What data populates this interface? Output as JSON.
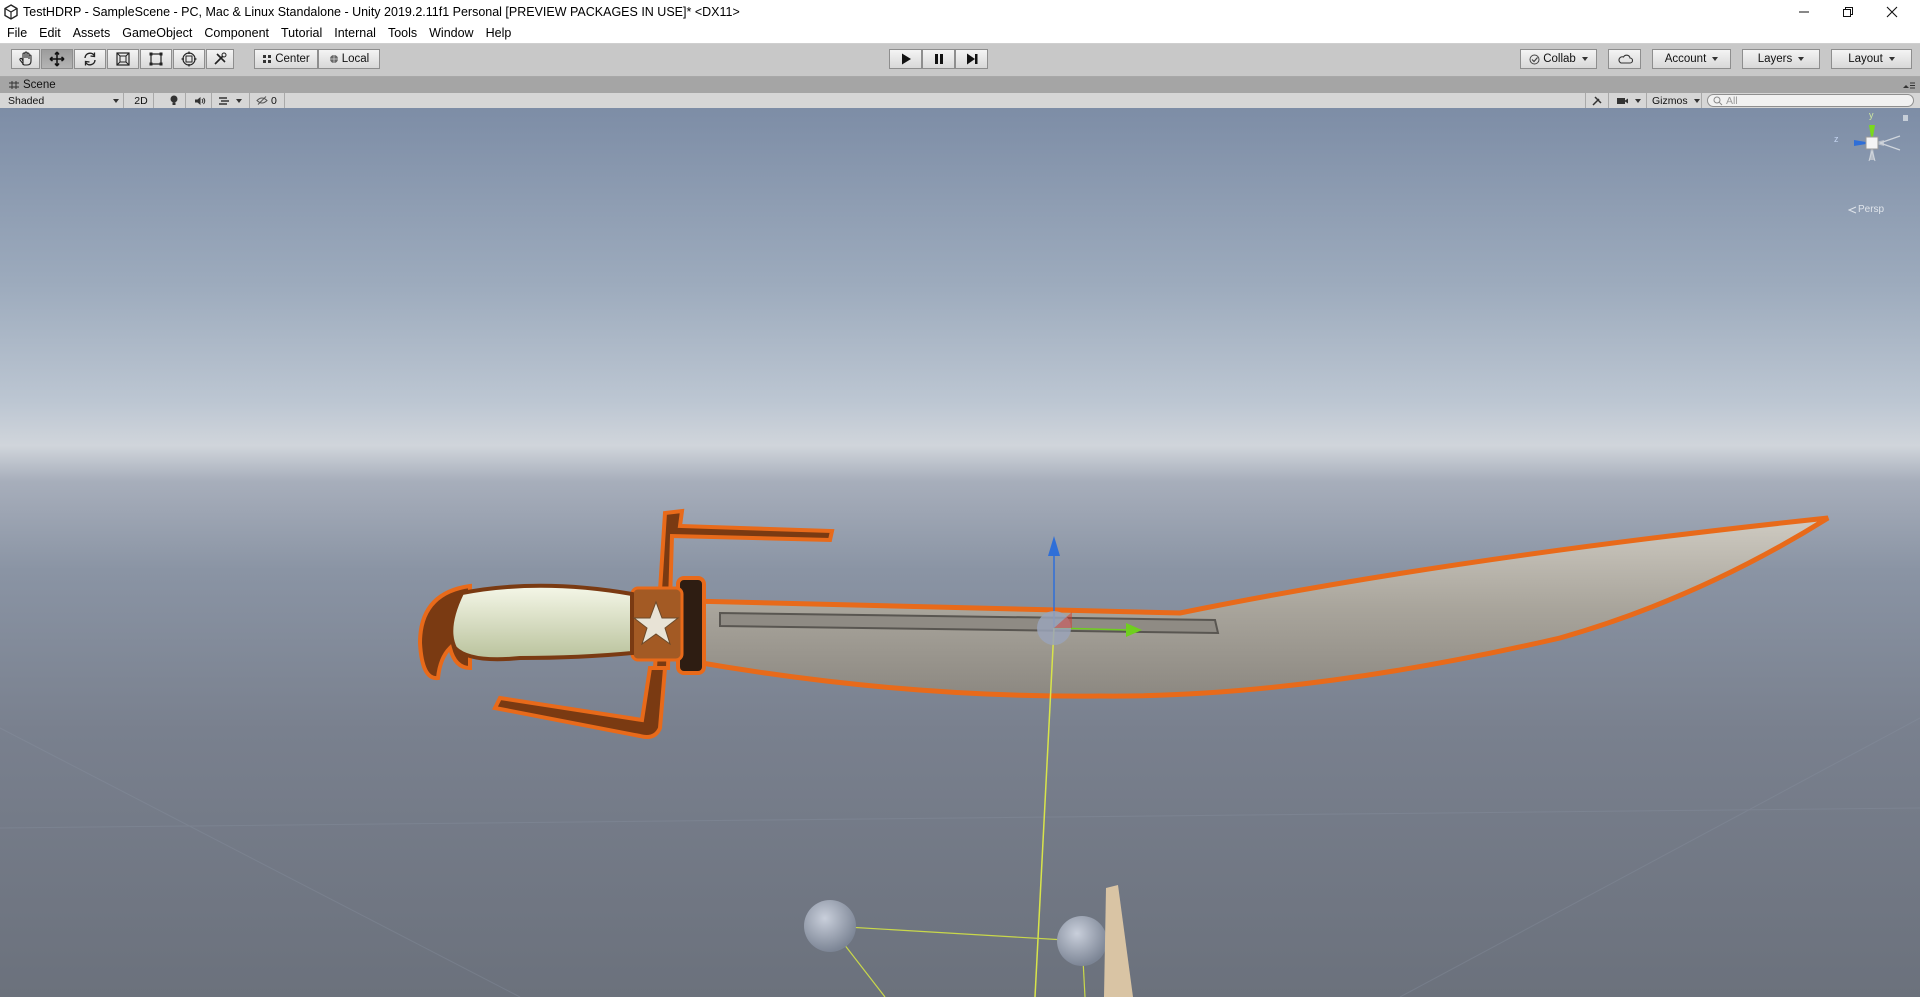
{
  "window": {
    "title": "TestHDRP - SampleScene - PC, Mac & Linux Standalone - Unity 2019.2.11f1 Personal [PREVIEW PACKAGES IN USE]* <DX11>"
  },
  "menu": [
    "File",
    "Edit",
    "Assets",
    "GameObject",
    "Component",
    "Tutorial",
    "Internal",
    "Tools",
    "Window",
    "Help"
  ],
  "toolbar": {
    "pivot_mode": "Center",
    "pivot_rotation": "Local",
    "collab_label": "Collab",
    "account_label": "Account",
    "layers_label": "Layers",
    "layout_label": "Layout"
  },
  "scene": {
    "tab_label": "Scene",
    "shading_mode": "Shaded",
    "mode_2d": "2D",
    "hidden_count": "0",
    "gizmos_label": "Gizmos",
    "search_placeholder": "All",
    "persp_label": "Persp",
    "axis_y": "y",
    "axis_z": "z"
  },
  "colors": {
    "selection_outline": "#e86a1a",
    "axis_y": "#7ad91e",
    "axis_z": "#2f6fd8",
    "axis_x": "#d83a2a"
  }
}
